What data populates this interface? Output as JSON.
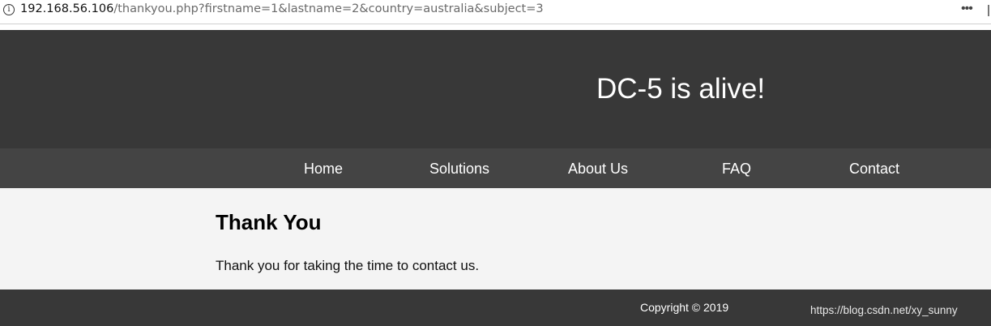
{
  "browser": {
    "info_icon": "info-icon",
    "url_host": "192.168.56.106",
    "url_path": "/thankyou.php?firstname=1&lastname=2&country=australia&subject=3",
    "more_icon": "more-horizontal-icon",
    "more_glyph": "•••"
  },
  "header": {
    "title": "DC-5 is alive!",
    "background": "#383838"
  },
  "nav": {
    "background": "#444444",
    "items": [
      {
        "label": "Home"
      },
      {
        "label": "Solutions"
      },
      {
        "label": "About Us"
      },
      {
        "label": "FAQ"
      },
      {
        "label": "Contact"
      }
    ]
  },
  "main": {
    "heading": "Thank You",
    "body": "Thank you for taking the time to contact us."
  },
  "footer": {
    "copyright": "Copyright © 2019",
    "watermark": "https://blog.csdn.net/xy_sunny"
  }
}
